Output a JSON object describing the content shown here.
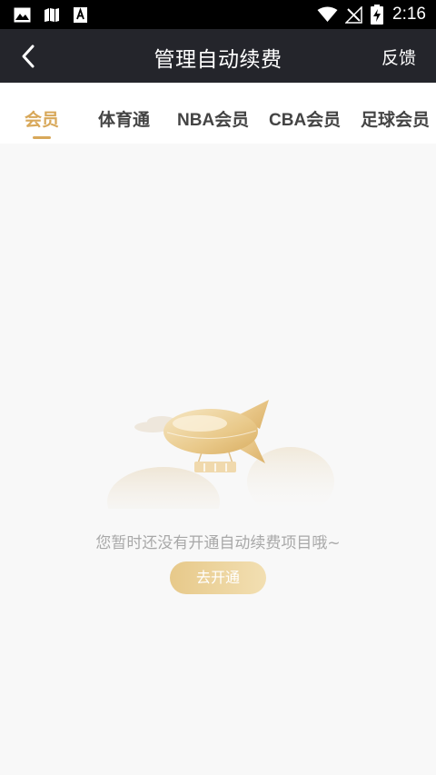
{
  "status_bar": {
    "time": "2:16",
    "left_icons": [
      "image-icon",
      "book-icon",
      "a-icon"
    ],
    "right_icons": [
      "wifi-icon",
      "no-signal-icon",
      "battery-charging-icon"
    ]
  },
  "nav": {
    "back_icon": "chevron-left-icon",
    "title": "管理自动续费",
    "feedback_label": "反馈"
  },
  "tabs": [
    {
      "label": "会员",
      "active": true
    },
    {
      "label": "体育通",
      "active": false
    },
    {
      "label": "NBA会员",
      "active": false
    },
    {
      "label": "CBA会员",
      "active": false
    },
    {
      "label": "足球会员",
      "active": false
    }
  ],
  "empty_state": {
    "illustration": "airship-icon",
    "message": "您暂时还没有开通自动续费项目哦~",
    "button_label": "去开通"
  },
  "colors": {
    "accent": "#d8a85a",
    "nav_background": "#24252b",
    "page_background": "#f8f8f8"
  }
}
